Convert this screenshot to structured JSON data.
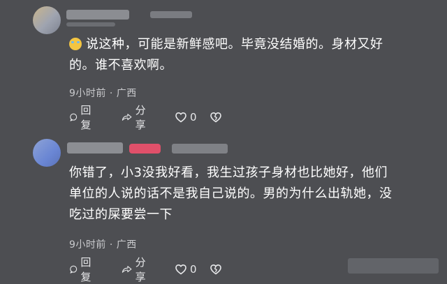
{
  "comments": [
    {
      "has_emoji": true,
      "emoji_icon": "laughing-tears-emoji-icon",
      "lines": [
        "说这种，可能是新鲜感吧。毕竟没结婚的。身材又好",
        "的。谁不喜欢啊。"
      ],
      "time": "9小时前",
      "separator": "·",
      "location": "广西",
      "reply_label": "回复",
      "share_label": "分享",
      "like_count": "0"
    },
    {
      "has_emoji": false,
      "lines": [
        "你错了，小3没我好看，我生过孩子身材也比她好，他们",
        "单位的人说的话不是我自己说的。男的为什么出轨她，没",
        "吃过的屎要尝一下"
      ],
      "time": "9小时前",
      "separator": "·",
      "location": "广西",
      "reply_label": "回复",
      "share_label": "分享",
      "like_count": "0"
    }
  ],
  "colors": {
    "background": "#4d4e52",
    "text": "#ffffff",
    "meta": "#c9cacd",
    "badge": "#e0506a"
  }
}
